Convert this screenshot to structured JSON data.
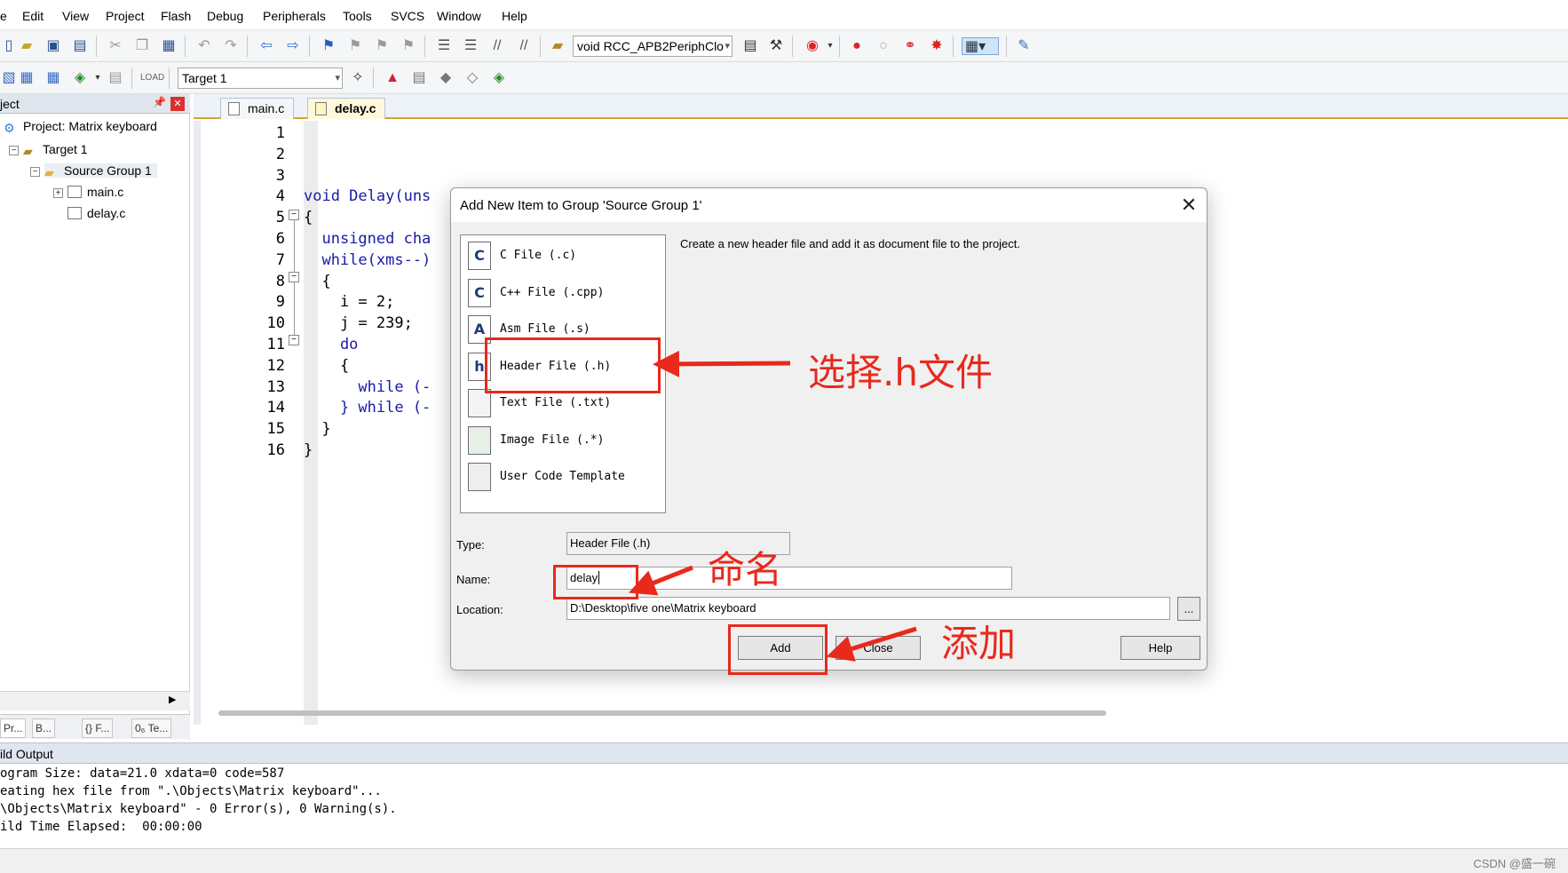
{
  "menubar": [
    "e",
    "Edit",
    "View",
    "Project",
    "Flash",
    "Debug",
    "Peripherals",
    "Tools",
    "SVCS",
    "Window",
    "Help"
  ],
  "toolbar1": {
    "function_combo": "void RCC_APB2PeriphClo"
  },
  "toolbar2": {
    "target_combo": "Target 1"
  },
  "project_panel": {
    "title": "ject",
    "project": "Project: Matrix keyboard",
    "target": "Target 1",
    "group": "Source Group 1",
    "files": [
      "main.c",
      "delay.c"
    ],
    "tabs": [
      "Pr...",
      "B...",
      "{} F...",
      "0₆ Te..."
    ]
  },
  "editor": {
    "tabs": [
      "main.c",
      "delay.c"
    ],
    "active_tab": "delay.c",
    "line_numbers": [
      "1",
      "2",
      "3",
      "4",
      "5",
      "6",
      "7",
      "8",
      "9",
      "10",
      "11",
      "12",
      "13",
      "14",
      "15",
      "16"
    ],
    "lines": [
      "",
      "",
      "",
      "void Delay(uns",
      "{",
      "  unsigned cha",
      "  while(xms--)",
      "  {",
      "    i = 2;",
      "    j = 239;",
      "    do",
      "    {",
      "      while (-",
      "    } while (-",
      "  }",
      "}"
    ]
  },
  "dialog": {
    "title": "Add New Item to Group 'Source Group 1'",
    "items": [
      {
        "icon": "C",
        "label": "C File (.c)"
      },
      {
        "icon": "C",
        "label": "C++ File (.cpp)"
      },
      {
        "icon": "A",
        "label": "Asm File (.s)"
      },
      {
        "icon": "h",
        "label": "Header File (.h)"
      },
      {
        "icon": "",
        "label": "Text File (.txt)"
      },
      {
        "icon": "",
        "label": "Image File (.*)"
      },
      {
        "icon": "",
        "label": "User Code Template"
      }
    ],
    "description": "Create a new header file and add it as document file to the project.",
    "type_label": "Type:",
    "type_value": "Header File (.h)",
    "name_label": "Name:",
    "name_value": "delay",
    "location_label": "Location:",
    "location_value": "D:\\Desktop\\five one\\Matrix keyboard",
    "browse": "...",
    "add": "Add",
    "close": "Close",
    "help": "Help"
  },
  "annotations": {
    "select": "选择.h文件",
    "name": "命名",
    "add": "添加",
    "color": "#e8291c"
  },
  "build_output": {
    "title": "ild Output",
    "lines": [
      "ogram Size: data=21.0 xdata=0 code=587",
      "eating hex file from \".\\Objects\\Matrix keyboard\"...",
      "\\Objects\\Matrix keyboard\" - 0 Error(s), 0 Warning(s).",
      "ild Time Elapsed:  00:00:00"
    ]
  },
  "watermark": "CSDN @盛一碗"
}
